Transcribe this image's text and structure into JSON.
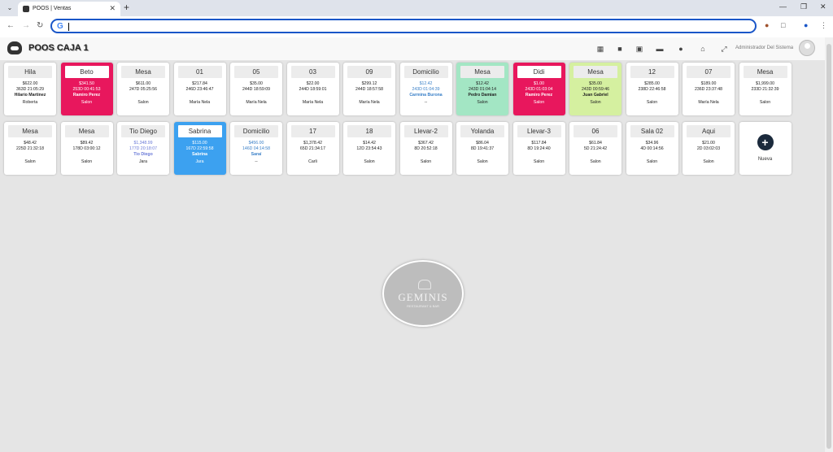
{
  "browser": {
    "tab_title": "POOS | Ventas",
    "search_icon": "google-g-icon"
  },
  "header": {
    "title": "POOS CAJA 1",
    "user": "Administrador Del Sistema",
    "icons": [
      "calendar-icon",
      "lock-icon",
      "document-icon",
      "card-icon",
      "user-gear-icon",
      "home-icon",
      "expand-icon"
    ]
  },
  "tables_row1": [
    {
      "name": "Hila",
      "total": "$622.00",
      "duration": "363D 21:05:29",
      "client": "Hilario Martinez",
      "area": "Roberta",
      "style": ""
    },
    {
      "name": "Beto",
      "total": "$341.50",
      "duration": "253D 00:41:53",
      "client": "Ramiro Perez",
      "area": "Salon",
      "style": "red"
    },
    {
      "name": "Mesa",
      "total": "$611.00",
      "duration": "247D 05:25:56",
      "client": "",
      "area": "Salon",
      "style": ""
    },
    {
      "name": "01",
      "total": "$217.84",
      "duration": "246D 23:46:47",
      "client": "",
      "area": "María Nela",
      "style": ""
    },
    {
      "name": "05",
      "total": "$35.00",
      "duration": "244D 18:59:09",
      "client": "",
      "area": "María Nela",
      "style": ""
    },
    {
      "name": "03",
      "total": "$22.00",
      "duration": "244D 18:59:01",
      "client": "",
      "area": "María Nela",
      "style": ""
    },
    {
      "name": "09",
      "total": "$299.12",
      "duration": "244D 18:57:58",
      "client": "",
      "area": "María Nela",
      "style": ""
    },
    {
      "name": "Domicilio",
      "total": "$12.42",
      "duration": "243D 01:04:39",
      "client": "Carmina Burona",
      "area": "--",
      "style": "link"
    },
    {
      "name": "Mesa",
      "total": "$12.42",
      "duration": "243D 01:04:14",
      "client": "Pedro Damian",
      "area": "Salon",
      "style": "mint"
    },
    {
      "name": "Didi",
      "total": "$1.00",
      "duration": "243D 01:03:04",
      "client": "Ramiro Perez",
      "area": "Salon",
      "style": "red"
    },
    {
      "name": "Mesa",
      "total": "$35.00",
      "duration": "243D 00:59:46",
      "client": "Juan Gabriel",
      "area": "Salon",
      "style": "lime"
    },
    {
      "name": "12",
      "total": "$285.00",
      "duration": "238D 22:46:58",
      "client": "",
      "area": "Salon",
      "style": ""
    },
    {
      "name": "07",
      "total": "$189.00",
      "duration": "236D 23:37:48",
      "client": "",
      "area": "María Nela",
      "style": ""
    },
    {
      "name": "Mesa",
      "total": "$1,999.00",
      "duration": "233D 21:32:39",
      "client": "",
      "area": "Salon",
      "style": ""
    }
  ],
  "tables_row2": [
    {
      "name": "Mesa",
      "total": "$48.42",
      "duration": "225D 21:32:18",
      "client": "",
      "area": "Salon",
      "style": ""
    },
    {
      "name": "Mesa",
      "total": "$89.42",
      "duration": "178D 03:00:12",
      "client": "",
      "area": "Salon",
      "style": ""
    },
    {
      "name": "Tio Diego",
      "total": "$1,348.99",
      "duration": "177D 20:18:07",
      "client": "Tio Diego",
      "area": "Jara",
      "style": "link2"
    },
    {
      "name": "Sabrina",
      "total": "$115.00",
      "duration": "167D 22:59:58",
      "client": "Sabrina",
      "area": "Jara",
      "style": "blue"
    },
    {
      "name": "Domicilio",
      "total": "$456.00",
      "duration": "146D 04:14:58",
      "client": "Saraí",
      "area": "--",
      "style": "link"
    },
    {
      "name": "17",
      "total": "$1,378.42",
      "duration": "65D 21:34:17",
      "client": "",
      "area": "Carli",
      "style": ""
    },
    {
      "name": "18",
      "total": "$14.42",
      "duration": "12D 23:54:43",
      "client": "",
      "area": "Salon",
      "style": ""
    },
    {
      "name": "Llevar-2",
      "total": "$367.42",
      "duration": "8D 20:52:18",
      "client": "",
      "area": "Salon",
      "style": ""
    },
    {
      "name": "Yolanda",
      "total": "$86.04",
      "duration": "8D 19:41:37",
      "client": "",
      "area": "Salon",
      "style": ""
    },
    {
      "name": "Llevar-3",
      "total": "$117.84",
      "duration": "8D 19:24:40",
      "client": "",
      "area": "Salon",
      "style": ""
    },
    {
      "name": "06",
      "total": "$61.84",
      "duration": "5D 21:24:42",
      "client": "",
      "area": "Salon",
      "style": ""
    },
    {
      "name": "Sala 02",
      "total": "$34.96",
      "duration": "4D 00:14:56",
      "client": "",
      "area": "Salon",
      "style": ""
    },
    {
      "name": "Aqui",
      "total": "$21.00",
      "duration": "2D 03:02:03",
      "client": "",
      "area": "Salon",
      "style": ""
    }
  ],
  "new_button": {
    "label": "Nueva"
  },
  "brand": {
    "name": "GEMINIS",
    "subtitle": "RESTAURANT & BAR"
  }
}
